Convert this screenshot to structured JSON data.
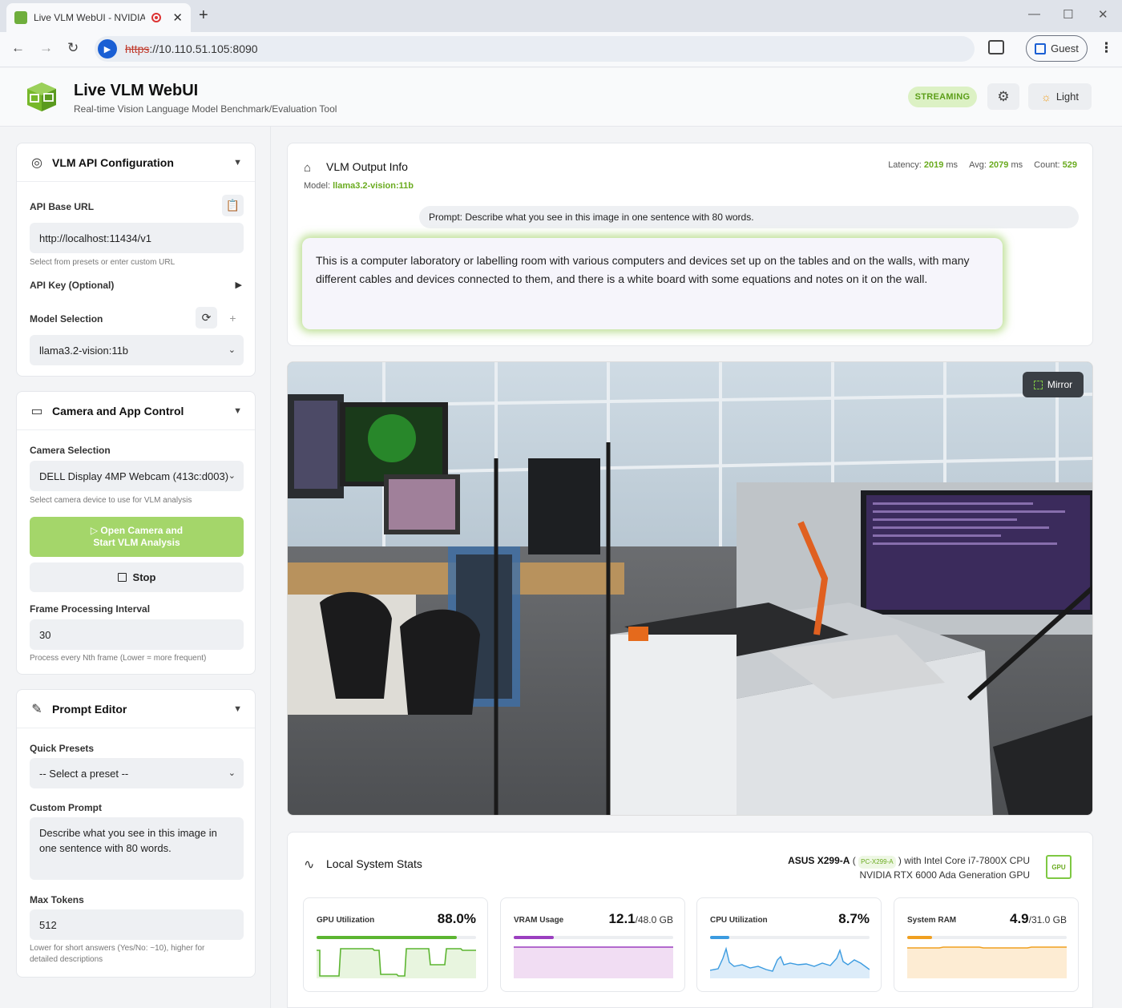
{
  "browser": {
    "tab_title": "Live VLM WebUI - NVIDIA",
    "url_proto": "https",
    "url_rest": "://10.110.51.105:8090",
    "profile_label": "Guest"
  },
  "header": {
    "title": "Live VLM WebUI",
    "subtitle": "Real-time Vision Language Model Benchmark/Evaluation Tool",
    "status_badge": "STREAMING",
    "theme_label": "Light"
  },
  "api_config": {
    "title": "VLM API Configuration",
    "base_url_label": "API Base URL",
    "base_url_value": "http://localhost:11434/v1",
    "base_url_hint": "Select from presets or enter custom URL",
    "api_key_label": "API Key (Optional)",
    "model_label": "Model Selection",
    "model_value": "llama3.2-vision:11b"
  },
  "camera": {
    "title": "Camera and App Control",
    "camera_label": "Camera Selection",
    "camera_value": "DELL Display 4MP Webcam (413c:d003)",
    "camera_hint": "Select camera device to use for VLM analysis",
    "start_line1": "Open Camera and",
    "start_line2": "Start VLM Analysis",
    "stop_label": "Stop",
    "interval_label": "Frame Processing Interval",
    "interval_value": "30",
    "interval_hint": "Process every Nth frame (Lower = more frequent)"
  },
  "prompt_editor": {
    "title": "Prompt Editor",
    "presets_label": "Quick Presets",
    "presets_value": "-- Select a preset --",
    "custom_label": "Custom Prompt",
    "custom_value": "Describe what you see in this image in one sentence with 80 words.",
    "max_tokens_label": "Max Tokens",
    "max_tokens_value": "512",
    "max_tokens_hint": "Lower for short answers (Yes/No: ~10), higher for detailed descriptions"
  },
  "output": {
    "title": "VLM Output Info",
    "model_prefix": "Model:",
    "model_name": "llama3.2-vision:11b",
    "latency_label": "Latency:",
    "latency_value": "2019",
    "avg_label": "Avg:",
    "avg_value": "2079",
    "unit": "ms",
    "count_label": "Count:",
    "count_value": "529",
    "prompt_text": "Prompt: Describe what you see in this image in one sentence with 80 words.",
    "response_text": "This is a computer laboratory or labelling room with various computers and devices set up on the tables and on the walls, with many different cables and devices connected to them, and there is a white board with some equations and notes on it on the wall."
  },
  "video": {
    "mirror_label": "Mirror"
  },
  "system_stats": {
    "title": "Local System Stats",
    "host_name": "ASUS X299-A",
    "host_id": "PC-X299-A",
    "cpu_name": "with Intel Core i7-7800X CPU",
    "gpu_name": "NVIDIA RTX 6000 Ada Generation GPU",
    "gpu_badge": "GPU",
    "cards": [
      {
        "label": "GPU Utilization",
        "value": "88.0%",
        "unit": "",
        "fraction": 0.88,
        "color": "#5cb531",
        "area": "#e8f5df"
      },
      {
        "label": "VRAM Usage",
        "value": "12.1",
        "unit": "/48.0 GB",
        "fraction": 0.252,
        "color": "#9b3fc0",
        "area": "#f1ddf3"
      },
      {
        "label": "CPU Utilization",
        "value": "8.7%",
        "unit": "",
        "fraction": 0.12,
        "color": "#3b9be0",
        "area": "#dcecf9"
      },
      {
        "label": "System RAM",
        "value": "4.9",
        "unit": "/31.0 GB",
        "fraction": 0.158,
        "color": "#f0a020",
        "area": "#fdecd3"
      }
    ]
  }
}
